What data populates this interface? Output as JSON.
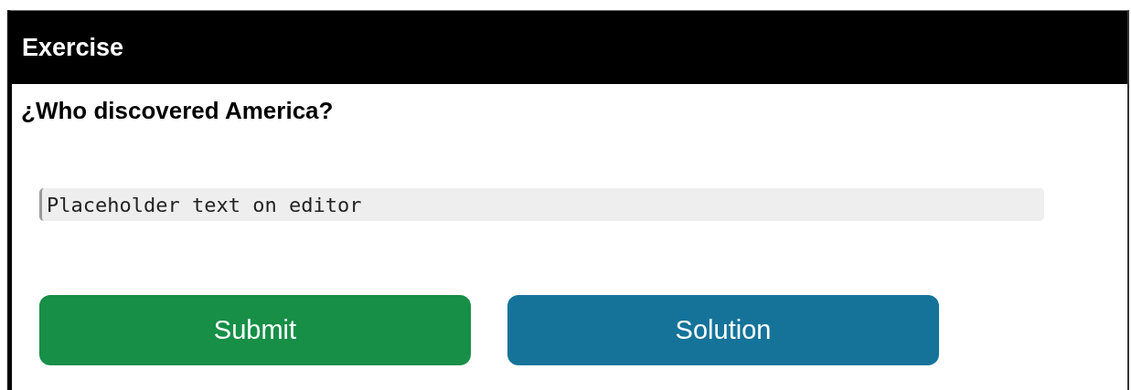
{
  "panel": {
    "title": "Exercise"
  },
  "question": "¿Who discovered America?",
  "editor": {
    "placeholder": "Placeholder text on editor"
  },
  "buttons": [
    {
      "label": "Submit",
      "kind": "submit"
    },
    {
      "label": "Solution",
      "kind": "solution"
    }
  ]
}
